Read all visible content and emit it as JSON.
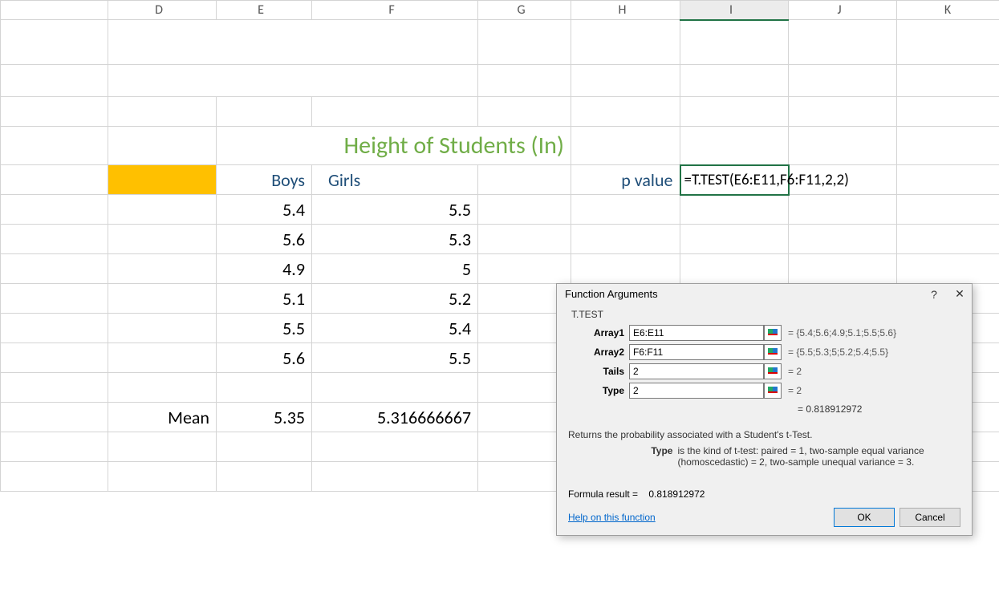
{
  "columns": [
    "D",
    "E",
    "F",
    "G",
    "H",
    "I",
    "J",
    "K"
  ],
  "selected_column": "I",
  "title_bar": "T-TEST",
  "section_title": "Height of Students (In)",
  "headers": {
    "boys": "Boys",
    "girls": "Girls"
  },
  "boys": [
    "5.4",
    "5.6",
    "4.9",
    "5.1",
    "5.5",
    "5.6"
  ],
  "girls": [
    "5.5",
    "5.3",
    "5",
    "5.2",
    "5.4",
    "5.5"
  ],
  "mean_label": "Mean",
  "mean_boys": "5.35",
  "mean_girls": "5.316666667",
  "pvalue_label": "p value",
  "formula": "=T.TEST(E6:E11,F6:F11,2,2)",
  "dialog": {
    "title": "Function Arguments",
    "fn": "T.TEST",
    "args": [
      {
        "label": "Array1",
        "value": "E6:E11",
        "result": "=  {5.4;5.6;4.9;5.1;5.5;5.6}"
      },
      {
        "label": "Array2",
        "value": "F6:F11",
        "result": "=  {5.5;5.3;5;5.2;5.4;5.5}"
      },
      {
        "label": "Tails",
        "value": "2",
        "result": "=  2"
      },
      {
        "label": "Type",
        "value": "2",
        "result": "=  2"
      }
    ],
    "eq_result": "=  0.818912972",
    "description": "Returns the probability associated with a Student's t-Test.",
    "detail_label": "Type",
    "detail_text": "is the kind of t-test: paired = 1, two-sample equal variance (homoscedastic) = 2, two-sample unequal variance = 3.",
    "formula_result_label": "Formula result =",
    "formula_result_value": "0.818912972",
    "help_link": "Help on this function",
    "ok": "OK",
    "cancel": "Cancel"
  }
}
